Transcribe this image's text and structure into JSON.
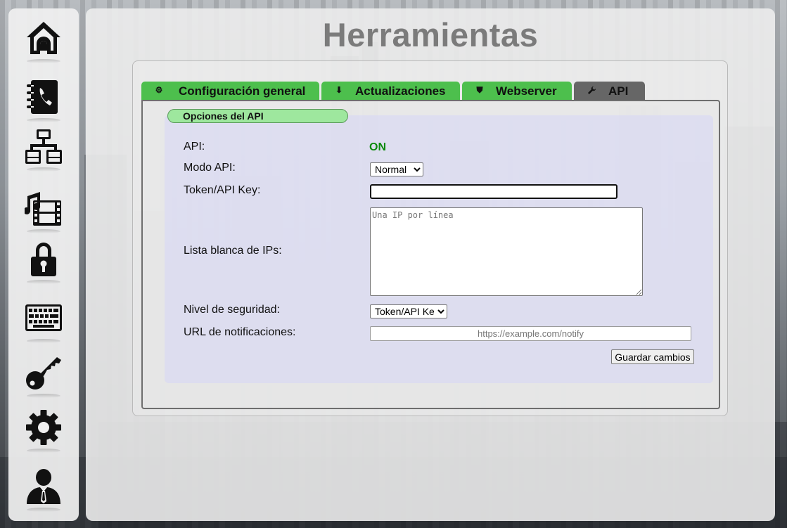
{
  "page": {
    "title": "Herramientas"
  },
  "sidebar": {
    "items": [
      {
        "icon": "home-icon"
      },
      {
        "icon": "phonebook-icon"
      },
      {
        "icon": "network-icon"
      },
      {
        "icon": "media-icon"
      },
      {
        "icon": "padlock-icon"
      },
      {
        "icon": "keyboard-icon"
      },
      {
        "icon": "key-icon"
      },
      {
        "icon": "gear-icon"
      },
      {
        "icon": "user-icon"
      }
    ]
  },
  "tabs": [
    {
      "label": "Configuración general",
      "icon": "gear-icon",
      "glyph": "⚙"
    },
    {
      "label": "Actualizaciones",
      "icon": "download-icon",
      "glyph": "⬇"
    },
    {
      "label": "Webserver",
      "icon": "shield-icon",
      "glyph": "⛊"
    },
    {
      "label": "API",
      "icon": "wrench-icon",
      "glyph": "🔧",
      "active": true
    }
  ],
  "api": {
    "section_title": "Opciones del API",
    "api_label": "API:",
    "api_status": "ON",
    "mode_label": "Modo API:",
    "mode_selected": "Normal",
    "token_label": "Token/API Key:",
    "token_value": "",
    "whitelist_label": "Lista blanca de IPs:",
    "whitelist_placeholder": "Una IP por línea",
    "security_label": "Nivel de seguridad:",
    "security_selected": "Token/API Key",
    "notify_label": "URL de notificaciones:",
    "notify_placeholder": "https://example.com/notify",
    "save_label": "Guardar cambios"
  },
  "colors": {
    "tab_green": "#4dbf4d",
    "tab_active": "#666666",
    "status_on": "#0d8a0d",
    "section_pill": "#9ee79e"
  }
}
